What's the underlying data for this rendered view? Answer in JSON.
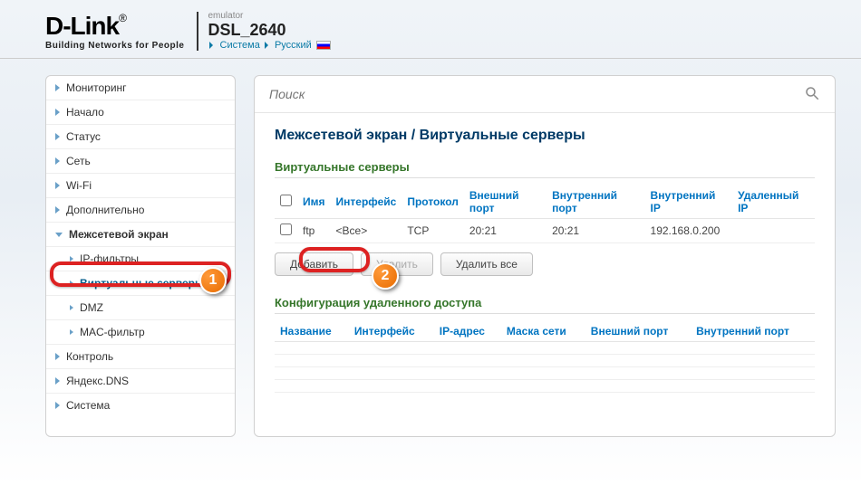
{
  "header": {
    "logo_text": "D-Link",
    "logo_reg": "®",
    "logo_tag": "Building Networks for People",
    "emulator": "emulator",
    "model": "DSL_2640",
    "bc_system": "Система",
    "bc_lang": "Русский"
  },
  "sidebar": {
    "items": [
      {
        "label": "Мониторинг"
      },
      {
        "label": "Начало"
      },
      {
        "label": "Статус"
      },
      {
        "label": "Сеть"
      },
      {
        "label": "Wi-Fi"
      },
      {
        "label": "Дополнительно"
      },
      {
        "label": "Межсетевой экран"
      },
      {
        "label": "Контроль"
      },
      {
        "label": "Яндекс.DNS"
      },
      {
        "label": "Система"
      }
    ],
    "subs": [
      {
        "label": "IP-фильтры"
      },
      {
        "label": "Виртуальные серверы"
      },
      {
        "label": "DMZ"
      },
      {
        "label": "MAC-фильтр"
      }
    ]
  },
  "search": {
    "placeholder": "Поиск"
  },
  "page_title": "Межсетевой экран /  Виртуальные серверы",
  "vs": {
    "section": "Виртуальные серверы",
    "headers": [
      "Имя",
      "Интерфейс",
      "Протокол",
      "Внешний порт",
      "Внутренний порт",
      "Внутренний IP",
      "Удаленный IP"
    ],
    "rows": [
      {
        "name": "ftp",
        "iface": "<Все>",
        "proto": "TCP",
        "ext": "20:21",
        "int": "20:21",
        "ip": "192.168.0.200",
        "rip": ""
      }
    ]
  },
  "buttons": {
    "add": "Добавить",
    "del": "Удалить",
    "delall": "Удалить все"
  },
  "ra": {
    "section": "Конфигурация удаленного доступа",
    "headers": [
      "Название",
      "Интерфейс",
      "IP-адрес",
      "Маска сети",
      "Внешний порт",
      "Внутренний порт"
    ]
  },
  "anno": {
    "b1": "1",
    "b2": "2"
  }
}
